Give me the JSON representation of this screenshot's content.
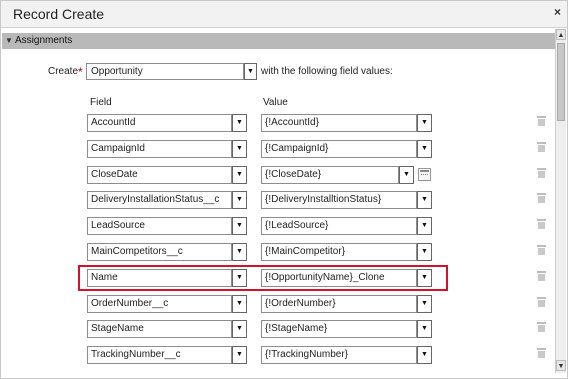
{
  "dialog": {
    "title": "Record Create",
    "close_glyph": "×",
    "close_icon": "close-icon"
  },
  "section": {
    "label": "Assignments",
    "toggle_glyph": "▼",
    "toggle_icon": "collapse-triangle-icon"
  },
  "create": {
    "label": "Create",
    "required_marker": "*",
    "object": "Opportunity",
    "suffix": "with the following field values:"
  },
  "columns": {
    "field": "Field",
    "value": "Value"
  },
  "assignments": [
    {
      "field": "AccountId",
      "value": "{!AccountId}",
      "has_calendar": false
    },
    {
      "field": "CampaignId",
      "value": "{!CampaignId}",
      "has_calendar": false
    },
    {
      "field": "CloseDate",
      "value": "{!CloseDate}",
      "has_calendar": true
    },
    {
      "field": "DeliveryInstallationStatus__c",
      "value": "{!DeliveryInstalltionStatus}",
      "has_calendar": false
    },
    {
      "field": "LeadSource",
      "value": "{!LeadSource}",
      "has_calendar": false
    },
    {
      "field": "MainCompetitors__c",
      "value": "{!MainCompetitor}",
      "has_calendar": false
    },
    {
      "field": "Name",
      "value": "{!OpportunityName}_Clone",
      "has_calendar": false
    },
    {
      "field": "OrderNumber__c",
      "value": "{!OrderNumber}",
      "has_calendar": false
    },
    {
      "field": "StageName",
      "value": "{!StageName}",
      "has_calendar": false
    },
    {
      "field": "TrackingNumber__c",
      "value": "{!TrackingNumber}",
      "has_calendar": false
    }
  ],
  "highlighted_row": "Name",
  "icons": {
    "dropdown": "▼",
    "delete": "trash-icon",
    "calendar": "calendar-icon",
    "scroll_up": "▲",
    "scroll_down": "▼"
  },
  "colors": {
    "highlight": "#d4112b",
    "required": "#cc0000",
    "section_bar": "#b9b9b9"
  }
}
